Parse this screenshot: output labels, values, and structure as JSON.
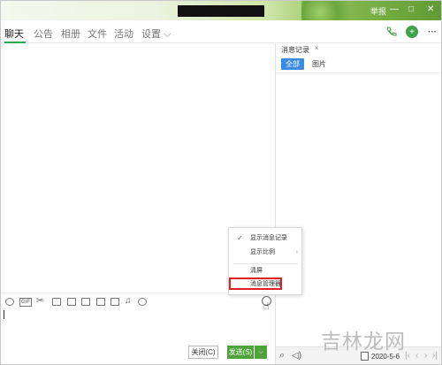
{
  "window": {
    "title_redacted": true,
    "title_text": "举报",
    "min_label": "—",
    "max_label": "□",
    "close_label": "✕"
  },
  "tabs": [
    {
      "label": "聊天",
      "active": true
    },
    {
      "label": "公告"
    },
    {
      "label": "相册"
    },
    {
      "label": "文件"
    },
    {
      "label": "活动"
    },
    {
      "label": "设置 ⌵"
    }
  ],
  "toolbar_icons": [
    "phone-icon",
    "add-icon",
    "more-icon"
  ],
  "records": {
    "tab_label": "消息记录",
    "close_label": "×",
    "filter_all": "全部",
    "filter_pic": "图片",
    "date": "2020-5-6"
  },
  "context_menu": {
    "items": [
      {
        "label": "显示消息记录",
        "checked": true
      },
      {
        "label": "显示比例",
        "submenu": true
      },
      {
        "label": "清屏"
      },
      {
        "label": "消息管理器",
        "highlighted": true
      }
    ]
  },
  "actions": {
    "close_label": "关闭(C)",
    "send_label": "发送(S)",
    "send_dropdown": "⌵"
  },
  "watermark": "吉林龙网",
  "colors": {
    "accent_green": "#4ea43a",
    "accent_blue": "#3b8be5",
    "highlight_red": "#e02020"
  }
}
